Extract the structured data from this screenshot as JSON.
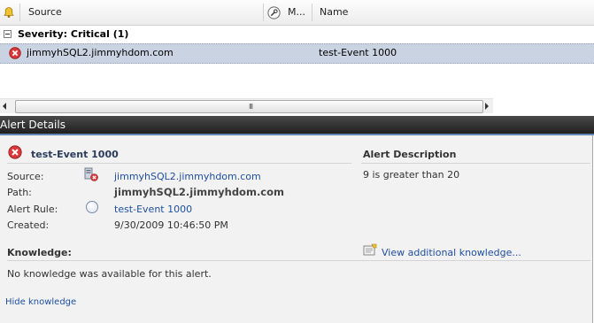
{
  "grid": {
    "columns": {
      "source": "Source",
      "m": "M...",
      "name": "Name"
    },
    "group": {
      "label": "Severity: Critical (1)"
    },
    "rows": [
      {
        "source": "jimmyhSQL2.jimmyhdom.com",
        "name": "test-Event 1000"
      }
    ],
    "scroll_grip": "III"
  },
  "details_pane": {
    "title": "Alert Details",
    "alert_title": "test-Event 1000",
    "fields": {
      "source_label": "Source:",
      "source_value": "jimmyhSQL2.jimmyhdom.com",
      "path_label": "Path:",
      "path_value": "jimmyhSQL2.jimmyhdom.com",
      "rule_label": "Alert Rule:",
      "rule_value": "test-Event 1000",
      "created_label": "Created:",
      "created_value": "9/30/2009 10:46:50 PM"
    },
    "description": {
      "heading": "Alert Description",
      "text": "9 is greater than 20"
    },
    "knowledge": {
      "heading": "Knowledge:",
      "view_link": "View additional knowledge...",
      "empty_text": "No knowledge was available for this alert.",
      "hide_link": "Hide knowledge"
    }
  },
  "colors": {
    "selection": "#c9d3e2",
    "link": "#1f4fa0",
    "critical": "#d9383a"
  }
}
